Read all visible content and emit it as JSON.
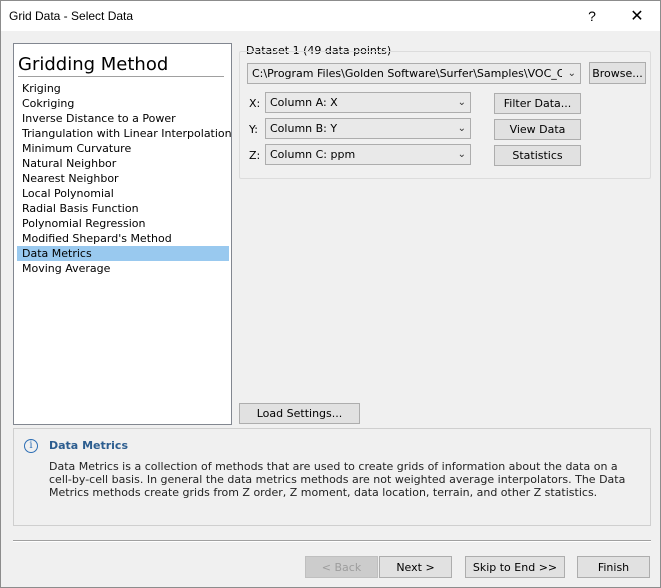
{
  "window": {
    "title": "Grid Data - Select Data",
    "help_glyph": "?",
    "close_glyph": "✕"
  },
  "gridding": {
    "title": "Gridding Method",
    "methods": [
      "Kriging",
      "Cokriging",
      "Inverse Distance to a Power",
      "Triangulation with Linear Interpolation",
      "Minimum Curvature",
      "Natural Neighbor",
      "Nearest Neighbor",
      "Local Polynomial",
      "Radial Basis Function",
      "Polynomial Regression",
      "Modified Shepard's Method",
      "Data Metrics",
      "Moving Average"
    ],
    "selected": "Data Metrics"
  },
  "dataset": {
    "label": "Dataset 1   (49 data points)",
    "path": "C:\\Program Files\\Golden Software\\Surfer\\Samples\\VOC_Concentrations.dat",
    "browse_label": "Browse...",
    "x_label": "X:",
    "x_value": "Column A:  X",
    "y_label": "Y:",
    "y_value": "Column B:  Y",
    "z_label": "Z:",
    "z_value": "Column C:  ppm",
    "filter_label": "Filter Data...",
    "view_label": "View Data",
    "stats_label": "Statistics"
  },
  "load_settings_label": "Load Settings...",
  "info": {
    "icon": "info-icon",
    "title": "Data Metrics",
    "text": "Data Metrics is a collection of methods that are used to create grids of information about the data on a cell-by-cell basis. In general the data metrics methods are not weighted average interpolators. The Data Metrics methods create grids from Z order, Z moment, data location, terrain, and other Z statistics."
  },
  "footer": {
    "back_label": "< Back",
    "next_label": "Next >",
    "skip_label": "Skip to End >>",
    "finish_label": "Finish"
  },
  "dropdown_glyph": "⌄"
}
